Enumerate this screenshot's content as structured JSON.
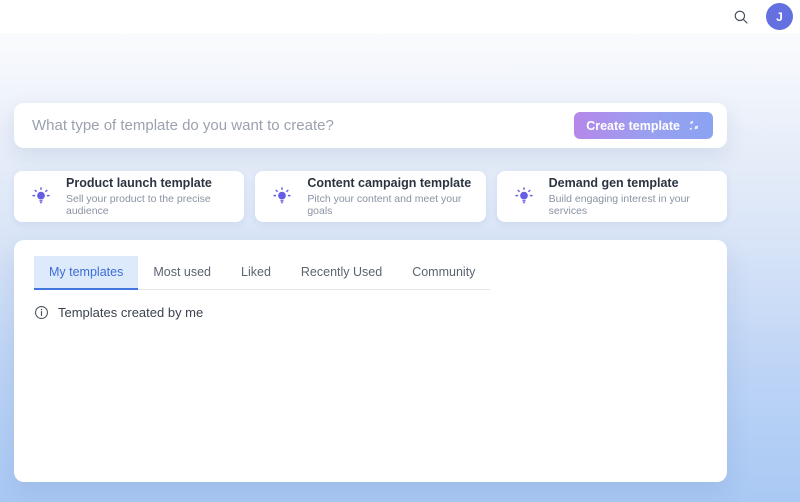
{
  "topbar": {
    "avatar_initial": "J"
  },
  "search": {
    "placeholder": "What type of template do you want to create?",
    "value": "",
    "button_label": "Create template"
  },
  "suggestions": [
    {
      "title": "Product launch template",
      "subtitle": "Sell your product to the precise audience"
    },
    {
      "title": "Content campaign template",
      "subtitle": "Pitch your content and meet your goals"
    },
    {
      "title": "Demand gen template",
      "subtitle": "Build engaging interest in your services"
    }
  ],
  "tabs": [
    {
      "label": "My templates",
      "active": true
    },
    {
      "label": "Most used",
      "active": false
    },
    {
      "label": "Liked",
      "active": false
    },
    {
      "label": "Recently Used",
      "active": false
    },
    {
      "label": "Community",
      "active": false
    }
  ],
  "panel": {
    "empty_message": "Templates created by me"
  },
  "colors": {
    "accent_gradient_start": "#b588ea",
    "accent_gradient_end": "#8ba3f2",
    "avatar_bg": "#6470e0",
    "active_tab_bg": "#dceafb",
    "active_tab_text": "#3d6ed8",
    "active_tab_underline": "#4076de",
    "bulb_icon_purple": "#655de4",
    "page_gradient_bottom": "#a9c9f4"
  }
}
